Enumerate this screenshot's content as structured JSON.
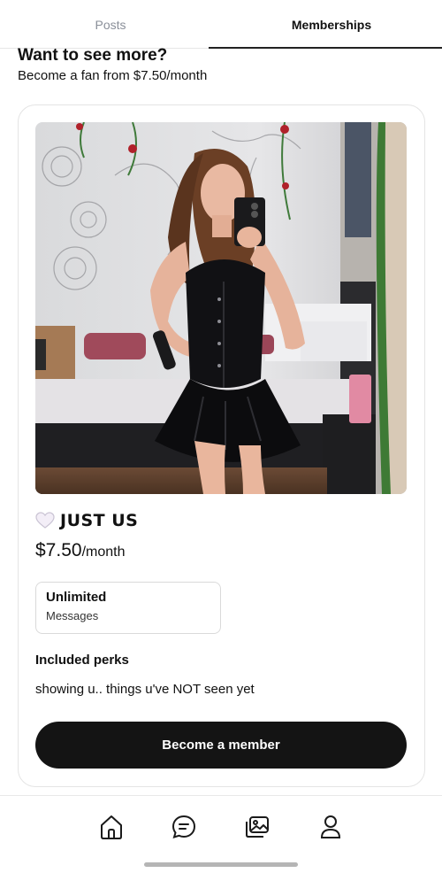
{
  "tabs": [
    {
      "label": "Posts",
      "active": false
    },
    {
      "label": "Memberships",
      "active": true
    }
  ],
  "promo": {
    "title": "Want to see more?",
    "subtitle": "Become a fan from $7.50/month"
  },
  "membership": {
    "tier_name": "JUST US",
    "tier_icon": "white-heart-icon",
    "price": "$7.50",
    "period": "/month",
    "benefit": {
      "title": "Unlimited",
      "subtitle": "Messages"
    },
    "perks_heading": "Included perks",
    "perks_text": "showing u.. things u've NOT seen yet",
    "cta_label": "Become a member"
  },
  "bottom_nav": [
    {
      "icon": "home-icon"
    },
    {
      "icon": "chat-icon"
    },
    {
      "icon": "gallery-icon"
    },
    {
      "icon": "profile-icon"
    }
  ],
  "colors": {
    "accent": "#141414",
    "inactive_tab": "#8a8f99",
    "card_border": "#e4e4e4"
  }
}
